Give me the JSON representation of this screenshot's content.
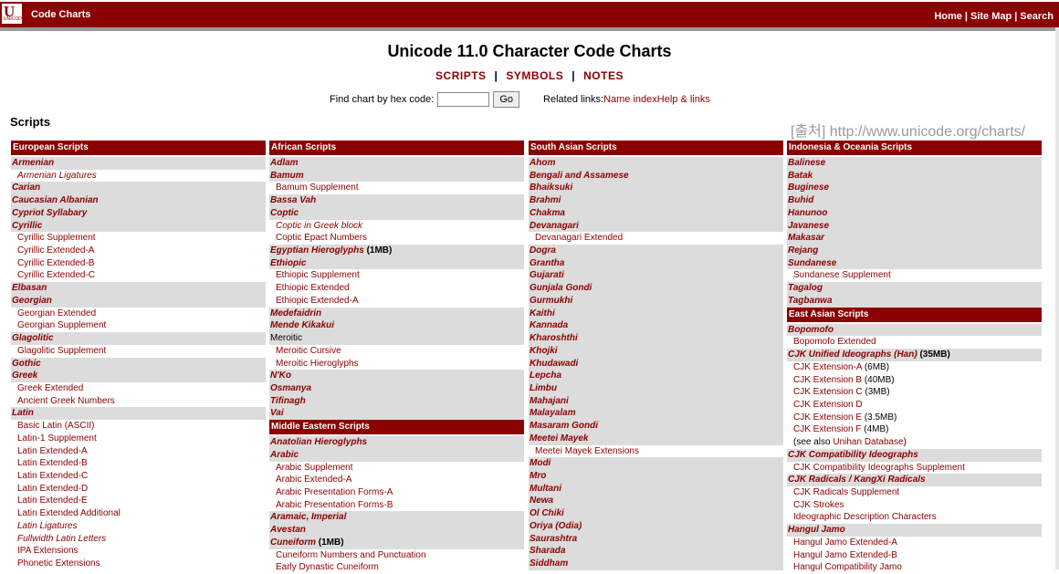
{
  "topbar": {
    "logo_letter": "U",
    "logo_small": "UNICODE",
    "title": "Code Charts",
    "links": [
      "Home",
      "Site Map",
      "Search"
    ]
  },
  "page_title": "Unicode 11.0 Character Code Charts",
  "tabs": [
    "SCRIPTS",
    "SYMBOLS",
    "NOTES"
  ],
  "find": {
    "label": "Find chart by hex code:",
    "input_value": "",
    "go": "Go"
  },
  "related": {
    "label": "Related links:",
    "links": [
      "Name index",
      "Help & links"
    ]
  },
  "scripts_heading": "Scripts",
  "watermark": "[출처] http://www.unicode.org/charts/",
  "columns": [
    {
      "sections": [
        {
          "header": "European Scripts",
          "items": [
            {
              "t": "Armenian",
              "k": "main"
            },
            {
              "t": "Armenian Ligatures",
              "k": "sub-it"
            },
            {
              "t": "Carian",
              "k": "main"
            },
            {
              "t": "Caucasian Albanian",
              "k": "main"
            },
            {
              "t": "Cypriot Syllabary",
              "k": "main"
            },
            {
              "t": "Cyrillic",
              "k": "main"
            },
            {
              "t": "Cyrillic Supplement",
              "k": "sub"
            },
            {
              "t": "Cyrillic Extended-A",
              "k": "sub"
            },
            {
              "t": "Cyrillic Extended-B",
              "k": "sub"
            },
            {
              "t": "Cyrillic Extended-C",
              "k": "sub"
            },
            {
              "t": "Elbasan",
              "k": "main"
            },
            {
              "t": "Georgian",
              "k": "main"
            },
            {
              "t": "Georgian Extended",
              "k": "sub"
            },
            {
              "t": "Georgian Supplement",
              "k": "sub"
            },
            {
              "t": "Glagolitic",
              "k": "main"
            },
            {
              "t": "Glagolitic Supplement",
              "k": "sub"
            },
            {
              "t": "Gothic",
              "k": "main"
            },
            {
              "t": "Greek",
              "k": "main"
            },
            {
              "t": "Greek Extended",
              "k": "sub"
            },
            {
              "t": "Ancient Greek Numbers",
              "k": "sub"
            },
            {
              "t": "Latin",
              "k": "main"
            },
            {
              "t": "Basic Latin (ASCII)",
              "k": "sub"
            },
            {
              "t": "Latin-1 Supplement",
              "k": "sub"
            },
            {
              "t": "Latin Extended-A",
              "k": "sub"
            },
            {
              "t": "Latin Extended-B",
              "k": "sub"
            },
            {
              "t": "Latin Extended-C",
              "k": "sub"
            },
            {
              "t": "Latin Extended-D",
              "k": "sub"
            },
            {
              "t": "Latin Extended-E",
              "k": "sub"
            },
            {
              "t": "Latin Extended Additional",
              "k": "sub"
            },
            {
              "t": "Latin Ligatures",
              "k": "sub-it"
            },
            {
              "t": "Fullwidth Latin Letters",
              "k": "sub-it"
            },
            {
              "t": "IPA Extensions",
              "k": "sub"
            },
            {
              "t": "Phonetic Extensions",
              "k": "sub"
            }
          ]
        }
      ]
    },
    {
      "sections": [
        {
          "header": "African Scripts",
          "items": [
            {
              "t": "Adlam",
              "k": "main"
            },
            {
              "t": "Bamum",
              "k": "main"
            },
            {
              "t": "Bamum Supplement",
              "k": "sub"
            },
            {
              "t": "Bassa Vah",
              "k": "main"
            },
            {
              "t": "Coptic",
              "k": "main"
            },
            {
              "t": "Coptic in Greek block",
              "k": "sub-it"
            },
            {
              "t": "Coptic Epact Numbers",
              "k": "sub"
            },
            {
              "t": "Egyptian Hieroglyphs",
              "k": "main",
              "note": " (1MB)"
            },
            {
              "t": "Ethiopic",
              "k": "main"
            },
            {
              "t": "Ethiopic Supplement",
              "k": "sub"
            },
            {
              "t": "Ethiopic Extended",
              "k": "sub"
            },
            {
              "t": "Ethiopic Extended-A",
              "k": "sub"
            },
            {
              "t": "Medefaidrin",
              "k": "main"
            },
            {
              "t": "Mende Kikakui",
              "k": "main"
            },
            {
              "t": "Meroitic",
              "k": "mainplain"
            },
            {
              "t": "Meroitic Cursive",
              "k": "sub"
            },
            {
              "t": "Meroitic Hieroglyphs",
              "k": "sub"
            },
            {
              "t": "N'Ko",
              "k": "main"
            },
            {
              "t": "Osmanya",
              "k": "main"
            },
            {
              "t": "Tifinagh",
              "k": "main"
            },
            {
              "t": "Vai",
              "k": "main"
            }
          ]
        },
        {
          "header": "Middle Eastern Scripts",
          "items": [
            {
              "t": "Anatolian Hieroglyphs",
              "k": "main"
            },
            {
              "t": "Arabic",
              "k": "main"
            },
            {
              "t": "Arabic Supplement",
              "k": "sub"
            },
            {
              "t": "Arabic Extended-A",
              "k": "sub"
            },
            {
              "t": "Arabic Presentation Forms-A",
              "k": "sub"
            },
            {
              "t": "Arabic Presentation Forms-B",
              "k": "sub"
            },
            {
              "t": "Aramaic, Imperial",
              "k": "main"
            },
            {
              "t": "Avestan",
              "k": "main"
            },
            {
              "t": "Cuneiform",
              "k": "main",
              "note": " (1MB)"
            },
            {
              "t": "Cuneiform Numbers and Punctuation",
              "k": "sub"
            },
            {
              "t": "Early Dynastic Cuneiform",
              "k": "sub"
            }
          ]
        }
      ]
    },
    {
      "sections": [
        {
          "header": "South Asian Scripts",
          "items": [
            {
              "t": "Ahom",
              "k": "main"
            },
            {
              "t": "Bengali and Assamese",
              "k": "main"
            },
            {
              "t": "Bhaiksuki",
              "k": "main"
            },
            {
              "t": "Brahmi",
              "k": "main"
            },
            {
              "t": "Chakma",
              "k": "main"
            },
            {
              "t": "Devanagari",
              "k": "main"
            },
            {
              "t": "Devanagari Extended",
              "k": "sub"
            },
            {
              "t": "Dogra",
              "k": "main"
            },
            {
              "t": "Grantha",
              "k": "main"
            },
            {
              "t": "Gujarati",
              "k": "main"
            },
            {
              "t": "Gunjala Gondi",
              "k": "main"
            },
            {
              "t": "Gurmukhi",
              "k": "main"
            },
            {
              "t": "Kaithi",
              "k": "main"
            },
            {
              "t": "Kannada",
              "k": "main"
            },
            {
              "t": "Kharoshthi",
              "k": "main"
            },
            {
              "t": "Khojki",
              "k": "main"
            },
            {
              "t": "Khudawadi",
              "k": "main"
            },
            {
              "t": "Lepcha",
              "k": "main"
            },
            {
              "t": "Limbu",
              "k": "main"
            },
            {
              "t": "Mahajani",
              "k": "main"
            },
            {
              "t": "Malayalam",
              "k": "main"
            },
            {
              "t": "Masaram Gondi",
              "k": "main"
            },
            {
              "t": "Meetei Mayek",
              "k": "main"
            },
            {
              "t": "Meetei Mayek Extensions",
              "k": "sub"
            },
            {
              "t": "Modi",
              "k": "main"
            },
            {
              "t": "Mro",
              "k": "main"
            },
            {
              "t": "Multani",
              "k": "main"
            },
            {
              "t": "Newa",
              "k": "main"
            },
            {
              "t": "Ol Chiki",
              "k": "main"
            },
            {
              "t": "Oriya (Odia)",
              "k": "main"
            },
            {
              "t": "Saurashtra",
              "k": "main"
            },
            {
              "t": "Sharada",
              "k": "main"
            },
            {
              "t": "Siddham",
              "k": "main"
            }
          ]
        }
      ]
    },
    {
      "sections": [
        {
          "header": "Indonesia & Oceania Scripts",
          "items": [
            {
              "t": "Balinese",
              "k": "main"
            },
            {
              "t": "Batak",
              "k": "main"
            },
            {
              "t": "Buginese",
              "k": "main"
            },
            {
              "t": "Buhid",
              "k": "main"
            },
            {
              "t": "Hanunoo",
              "k": "main"
            },
            {
              "t": "Javanese",
              "k": "main"
            },
            {
              "t": "Makasar",
              "k": "main"
            },
            {
              "t": "Rejang",
              "k": "main"
            },
            {
              "t": "Sundanese",
              "k": "main"
            },
            {
              "t": "Sundanese Supplement",
              "k": "sub"
            },
            {
              "t": "Tagalog",
              "k": "main"
            },
            {
              "t": "Tagbanwa",
              "k": "main"
            }
          ]
        },
        {
          "header": "East Asian Scripts",
          "items": [
            {
              "t": "Bopomofo",
              "k": "main"
            },
            {
              "t": "Bopomofo Extended",
              "k": "sub"
            },
            {
              "t": "CJK Unified Ideographs (Han)",
              "k": "main",
              "note": " (35MB)"
            },
            {
              "t": "CJK Extension-A",
              "k": "sub",
              "note": " (6MB)"
            },
            {
              "t": "CJK Extension B",
              "k": "sub",
              "note": " (40MB)"
            },
            {
              "t": "CJK Extension C",
              "k": "sub",
              "note": " (3MB)"
            },
            {
              "t": "CJK Extension D",
              "k": "sub"
            },
            {
              "t": "CJK Extension E",
              "k": "sub",
              "note": " (3.5MB)"
            },
            {
              "t": "CJK Extension F",
              "k": "sub",
              "note": " (4MB)"
            },
            {
              "t": "Unihan Database",
              "k": "sub",
              "pre": "(see also ",
              "note": ")"
            },
            {
              "t": "CJK Compatibility Ideographs",
              "k": "main"
            },
            {
              "t": "CJK Compatibility Ideographs Supplement",
              "k": "sub"
            },
            {
              "t": "CJK Radicals / KangXi Radicals",
              "k": "main"
            },
            {
              "t": "CJK Radicals Supplement",
              "k": "sub"
            },
            {
              "t": "CJK Strokes",
              "k": "sub"
            },
            {
              "t": "Ideographic Description Characters",
              "k": "sub"
            },
            {
              "t": "Hangul Jamo",
              "k": "main"
            },
            {
              "t": "Hangul Jamo Extended-A",
              "k": "sub"
            },
            {
              "t": "Hangul Jamo Extended-B",
              "k": "sub"
            },
            {
              "t": "Hangul Compatibility Jamo",
              "k": "sub"
            }
          ]
        }
      ]
    }
  ]
}
